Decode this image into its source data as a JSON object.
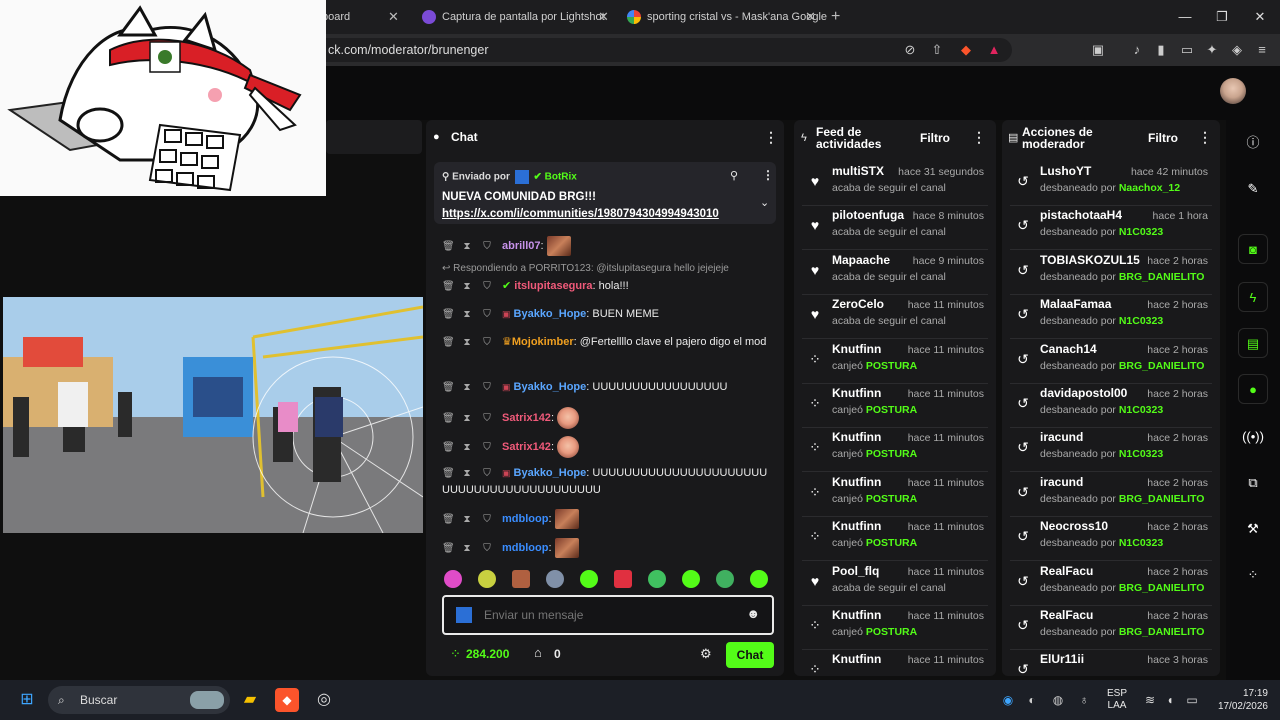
{
  "browser": {
    "tabs": [
      {
        "label": "board",
        "icon": "kick-icon"
      },
      {
        "label": "Captura de pantalla por Lightshot",
        "icon": "feather-icon"
      },
      {
        "label": "sporting cristal vs - Mask'ana Google",
        "icon": "google-icon"
      }
    ],
    "new_tab": "+",
    "url": "ck.com/moderator/brunenger",
    "window_controls": {
      "minimize": "—",
      "maximize": "❐",
      "close": "✕"
    }
  },
  "chat": {
    "title": "Chat",
    "pinned": {
      "label": "Enviado por",
      "sender": "BotRix",
      "text": "NUEVA COMUNIDAD BRG!!!",
      "link": "https://x.com/i/communities/1980794304994943010"
    },
    "reply_hint": "Respondiendo a PORRITO123: @itslupitasegura hello jejejeje",
    "messages": [
      {
        "user": "abrill07",
        "color": "#c792ea",
        "text": "",
        "emote": true
      },
      {
        "user": "itslupitasegura",
        "color": "#f05a7a",
        "text": "hola!!!",
        "emote": false
      },
      {
        "user": "Byakko_Hope",
        "color": "#5aa6ff",
        "text": "BUEN MEME",
        "emote": false
      },
      {
        "user": "Mojokimber",
        "color": "#f0a020",
        "text": "@Fertellllo clave el pajero digo el mod",
        "emote": false
      },
      {
        "user": "Byakko_Hope",
        "color": "#5aa6ff",
        "text": "UUUUUUUUUUUUUUUUU",
        "emote": false
      },
      {
        "user": "Satrix142",
        "color": "#f05a7a",
        "text": "",
        "emote": true
      },
      {
        "user": "Satrix142",
        "color": "#f05a7a",
        "text": "",
        "emote": true
      },
      {
        "user": "Byakko_Hope",
        "color": "#5aa6ff",
        "text": "UUUUUUUUUUUUUUUUUUUUUUUUUUUUUUUUUUUUUUUUUU",
        "emote": false
      },
      {
        "user": "mdbloop",
        "color": "#3a8dff",
        "text": "",
        "emote": true
      },
      {
        "user": "mdbloop",
        "color": "#3a8dff",
        "text": "",
        "emote": true
      }
    ],
    "input_placeholder": "Enviar un mensaje",
    "points": "284.200",
    "store_count": "0",
    "send_label": "Chat"
  },
  "feed": {
    "title_line1": "Feed de",
    "title_line2": "actividades",
    "filter": "Filtro",
    "items": [
      {
        "name": "multiSTX",
        "time": "hace 31 segundos",
        "sub": "acaba de seguir el canal",
        "reward": "",
        "icon": "heart-icon"
      },
      {
        "name": "pilotoenfuga",
        "time": "hace 8 minutos",
        "sub": "acaba de seguir el canal",
        "reward": "",
        "icon": "heart-icon"
      },
      {
        "name": "Mapaache",
        "time": "hace 9 minutos",
        "sub": "acaba de seguir el canal",
        "reward": "",
        "icon": "heart-icon"
      },
      {
        "name": "ZeroCelo",
        "time": "hace 11 minutos",
        "sub": "acaba de seguir el canal",
        "reward": "",
        "icon": "heart-icon"
      },
      {
        "name": "Knutfinn",
        "time": "hace 11 minutos",
        "sub": "canjeó",
        "reward": "POSTURA",
        "icon": "points-icon"
      },
      {
        "name": "Knutfinn",
        "time": "hace 11 minutos",
        "sub": "canjeó",
        "reward": "POSTURA",
        "icon": "points-icon"
      },
      {
        "name": "Knutfinn",
        "time": "hace 11 minutos",
        "sub": "canjeó",
        "reward": "POSTURA",
        "icon": "points-icon"
      },
      {
        "name": "Knutfinn",
        "time": "hace 11 minutos",
        "sub": "canjeó",
        "reward": "POSTURA",
        "icon": "points-icon"
      },
      {
        "name": "Knutfinn",
        "time": "hace 11 minutos",
        "sub": "canjeó",
        "reward": "POSTURA",
        "icon": "points-icon"
      },
      {
        "name": "Pool_flq",
        "time": "hace 11 minutos",
        "sub": "acaba de seguir el canal",
        "reward": "",
        "icon": "heart-icon"
      },
      {
        "name": "Knutfinn",
        "time": "hace 11 minutos",
        "sub": "canjeó",
        "reward": "POSTURA",
        "icon": "points-icon"
      },
      {
        "name": "Knutfinn",
        "time": "hace 11 minutos",
        "sub": "",
        "reward": "",
        "icon": "points-icon"
      }
    ]
  },
  "mod": {
    "title_line1": "Acciones de",
    "title_line2": "moderador",
    "filter": "Filtro",
    "items": [
      {
        "name": "LushoYT",
        "time": "hace 42 minutos",
        "sub": "desbaneado por",
        "by": "Naachox_12"
      },
      {
        "name": "pistachotaaH4",
        "time": "hace 1 hora",
        "sub": "desbaneado por",
        "by": "N1C0323"
      },
      {
        "name": "TOBIASKOZUL15",
        "time": "hace 2 horas",
        "sub": "desbaneado por",
        "by": "BRG_DANIELITO"
      },
      {
        "name": "MalaaFamaa",
        "time": "hace 2 horas",
        "sub": "desbaneado por",
        "by": "N1C0323"
      },
      {
        "name": "Canach14",
        "time": "hace 2 horas",
        "sub": "desbaneado por",
        "by": "BRG_DANIELITO"
      },
      {
        "name": "davidapostol00",
        "time": "hace 2 horas",
        "sub": "desbaneado por",
        "by": "N1C0323"
      },
      {
        "name": "iracund",
        "time": "hace 2 horas",
        "sub": "desbaneado por",
        "by": "N1C0323"
      },
      {
        "name": "iracund",
        "time": "hace 2 horas",
        "sub": "desbaneado por",
        "by": "BRG_DANIELITO"
      },
      {
        "name": "Neocross10",
        "time": "hace 2 horas",
        "sub": "desbaneado por",
        "by": "N1C0323"
      },
      {
        "name": "RealFacu",
        "time": "hace 2 horas",
        "sub": "desbaneado por",
        "by": "BRG_DANIELITO"
      },
      {
        "name": "RealFacu",
        "time": "hace 2 horas",
        "sub": "desbaneado por",
        "by": "BRG_DANIELITO"
      },
      {
        "name": "ElUr11ii",
        "time": "hace 3 horas",
        "sub": "",
        "by": ""
      }
    ]
  },
  "taskbar": {
    "search_placeholder": "Buscar",
    "lang_line1": "ESP",
    "lang_line2": "LAA",
    "time": "17:19",
    "date": "17/02/2026"
  },
  "colors": {
    "accent": "#53fc18",
    "panel": "#19191b",
    "background": "#0f0f0f"
  }
}
